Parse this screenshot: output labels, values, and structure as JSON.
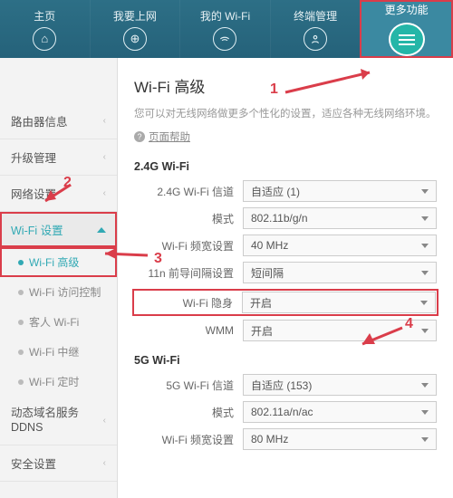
{
  "topnav": {
    "home": "主页",
    "internet": "我要上网",
    "wifi": "我的 Wi-Fi",
    "devices": "终端管理",
    "more": "更多功能"
  },
  "sidebar": {
    "router_info": "路由器信息",
    "upgrade": "升级管理",
    "network": "网络设置",
    "wifi_settings": "Wi-Fi 设置",
    "sub": {
      "advanced": "Wi-Fi 高级",
      "access": "Wi-Fi 访问控制",
      "guest": "客人 Wi-Fi",
      "repeater": "Wi-Fi 中继",
      "timer": "Wi-Fi 定时"
    },
    "ddns": "动态域名服务\nDDNS",
    "security": "安全设置"
  },
  "content": {
    "title": "Wi-Fi 高级",
    "desc": "您可以对无线网络做更多个性化的设置，适应各种无线网络环境。",
    "help": "页面帮助",
    "section24": "2.4G Wi-Fi",
    "section5": "5G Wi-Fi",
    "labels": {
      "channel24": "2.4G Wi-Fi 信道",
      "mode": "模式",
      "bandwidth": "Wi-Fi 频宽设置",
      "guard": "11n 前导间隔设置",
      "hidden": "Wi-Fi 隐身",
      "wmm": "WMM",
      "channel5": "5G Wi-Fi 信道"
    },
    "values": {
      "channel24": "自适应 (1)",
      "mode24": "802.11b/g/n",
      "bw24": "40 MHz",
      "guard": "短间隔",
      "hidden": "开启",
      "wmm": "开启",
      "channel5": "自适应 (153)",
      "mode5": "802.11a/n/ac",
      "bw5": "80 MHz"
    }
  },
  "anno": {
    "n1": "1",
    "n2": "2",
    "n3": "3",
    "n4": "4"
  }
}
